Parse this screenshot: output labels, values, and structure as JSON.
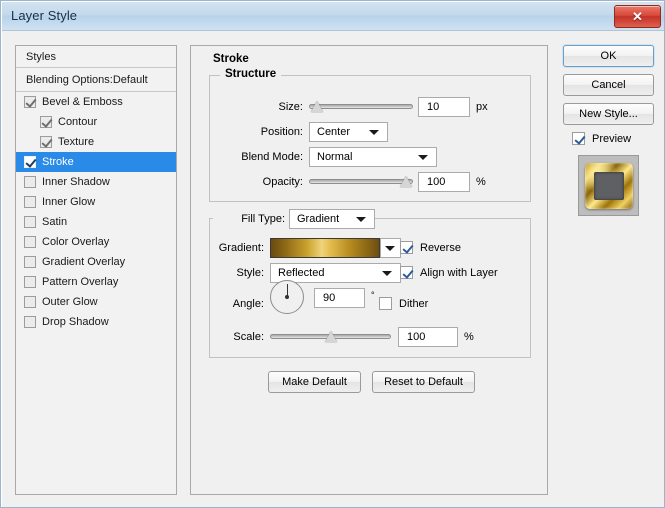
{
  "window": {
    "title": "Layer Style",
    "close_label": "✕"
  },
  "styles_panel": {
    "header": "Styles",
    "blending_options": "Blending Options:Default",
    "items": [
      {
        "label": "Bevel & Emboss",
        "checked": true,
        "indent": false,
        "selected": false
      },
      {
        "label": "Contour",
        "checked": true,
        "indent": true,
        "selected": false
      },
      {
        "label": "Texture",
        "checked": true,
        "indent": true,
        "selected": false
      },
      {
        "label": "Stroke",
        "checked": true,
        "indent": false,
        "selected": true
      },
      {
        "label": "Inner Shadow",
        "checked": false,
        "indent": false,
        "selected": false
      },
      {
        "label": "Inner Glow",
        "checked": false,
        "indent": false,
        "selected": false
      },
      {
        "label": "Satin",
        "checked": false,
        "indent": false,
        "selected": false
      },
      {
        "label": "Color Overlay",
        "checked": false,
        "indent": false,
        "selected": false
      },
      {
        "label": "Gradient Overlay",
        "checked": false,
        "indent": false,
        "selected": false
      },
      {
        "label": "Pattern Overlay",
        "checked": false,
        "indent": false,
        "selected": false
      },
      {
        "label": "Outer Glow",
        "checked": false,
        "indent": false,
        "selected": false
      },
      {
        "label": "Drop Shadow",
        "checked": false,
        "indent": false,
        "selected": false
      }
    ]
  },
  "main": {
    "panel_title": "Stroke",
    "structure": {
      "title": "Structure",
      "size_label": "Size:",
      "size_value": "10",
      "size_unit": "px",
      "size_percent": 8,
      "position_label": "Position:",
      "position_value": "Center",
      "blend_mode_label": "Blend Mode:",
      "blend_mode_value": "Normal",
      "opacity_label": "Opacity:",
      "opacity_value": "100",
      "opacity_unit": "%",
      "opacity_percent": 100
    },
    "fill": {
      "fill_type_label": "Fill Type:",
      "fill_type_value": "Gradient",
      "gradient_label": "Gradient:",
      "style_label": "Style:",
      "style_value": "Reflected",
      "angle_label": "Angle:",
      "angle_value": "90",
      "angle_unit": "°",
      "scale_label": "Scale:",
      "scale_value": "100",
      "scale_unit": "%",
      "scale_percent": 50,
      "reverse_label": "Reverse",
      "reverse_checked": true,
      "align_label": "Align with Layer",
      "align_checked": true,
      "dither_label": "Dither",
      "dither_checked": false
    },
    "buttons": {
      "make_default": "Make Default",
      "reset_to_default": "Reset to Default"
    }
  },
  "right": {
    "ok": "OK",
    "cancel": "Cancel",
    "new_style": "New Style...",
    "preview_label": "Preview",
    "preview_checked": true
  }
}
